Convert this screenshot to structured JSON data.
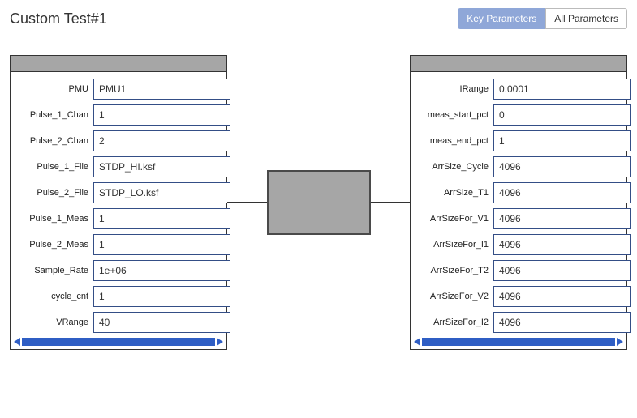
{
  "header": {
    "title": "Custom Test#1",
    "tab_key": "Key Parameters",
    "tab_all": "All Parameters"
  },
  "left": [
    {
      "label": "PMU",
      "value": "PMU1"
    },
    {
      "label": "Pulse_1_Chan",
      "value": "1"
    },
    {
      "label": "Pulse_2_Chan",
      "value": "2"
    },
    {
      "label": "Pulse_1_File",
      "value": "STDP_HI.ksf"
    },
    {
      "label": "Pulse_2_File",
      "value": "STDP_LO.ksf"
    },
    {
      "label": "Pulse_1_Meas",
      "value": "1"
    },
    {
      "label": "Pulse_2_Meas",
      "value": "1"
    },
    {
      "label": "Sample_Rate",
      "value": "1e+06"
    },
    {
      "label": "cycle_cnt",
      "value": "1"
    },
    {
      "label": "VRange",
      "value": "40"
    }
  ],
  "right": [
    {
      "label": "IRange",
      "value": "0.0001"
    },
    {
      "label": "meas_start_pct",
      "value": "0"
    },
    {
      "label": "meas_end_pct",
      "value": "1"
    },
    {
      "label": "ArrSize_Cycle",
      "value": "4096"
    },
    {
      "label": "ArrSize_T1",
      "value": "4096"
    },
    {
      "label": "ArrSizeFor_V1",
      "value": "4096"
    },
    {
      "label": "ArrSizeFor_I1",
      "value": "4096"
    },
    {
      "label": "ArrSizeFor_T2",
      "value": "4096"
    },
    {
      "label": "ArrSizeFor_V2",
      "value": "4096"
    },
    {
      "label": "ArrSizeFor_I2",
      "value": "4096"
    }
  ]
}
